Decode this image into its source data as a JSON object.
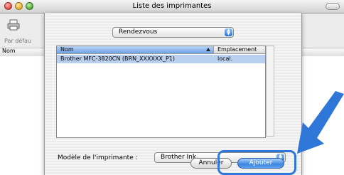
{
  "window": {
    "title": "Liste des imprimantes"
  },
  "toolbar": {
    "default_label": "Par défau"
  },
  "list": {
    "header_nom": "Nom"
  },
  "sheet": {
    "browser_popup": "Rendezvous",
    "table": {
      "columns": [
        "Nom",
        "Emplacement"
      ],
      "rows": [
        {
          "name": "Brother MFC-3820CN (BRN_XXXXXX_P1)",
          "location": "local."
        }
      ]
    },
    "model_label": "Modèle de l'imprimante :",
    "model_popup": "Brother Ink",
    "cancel_label": "Annuler",
    "add_label": "Ajouter"
  },
  "colors": {
    "accent": "#3e86e0",
    "callout": "#2e76d8",
    "selection": "#b9d0ef"
  },
  "icons": [
    "printer-icon",
    "popup-arrows-icon",
    "sort-ascending-icon",
    "callout-arrow-icon"
  ]
}
